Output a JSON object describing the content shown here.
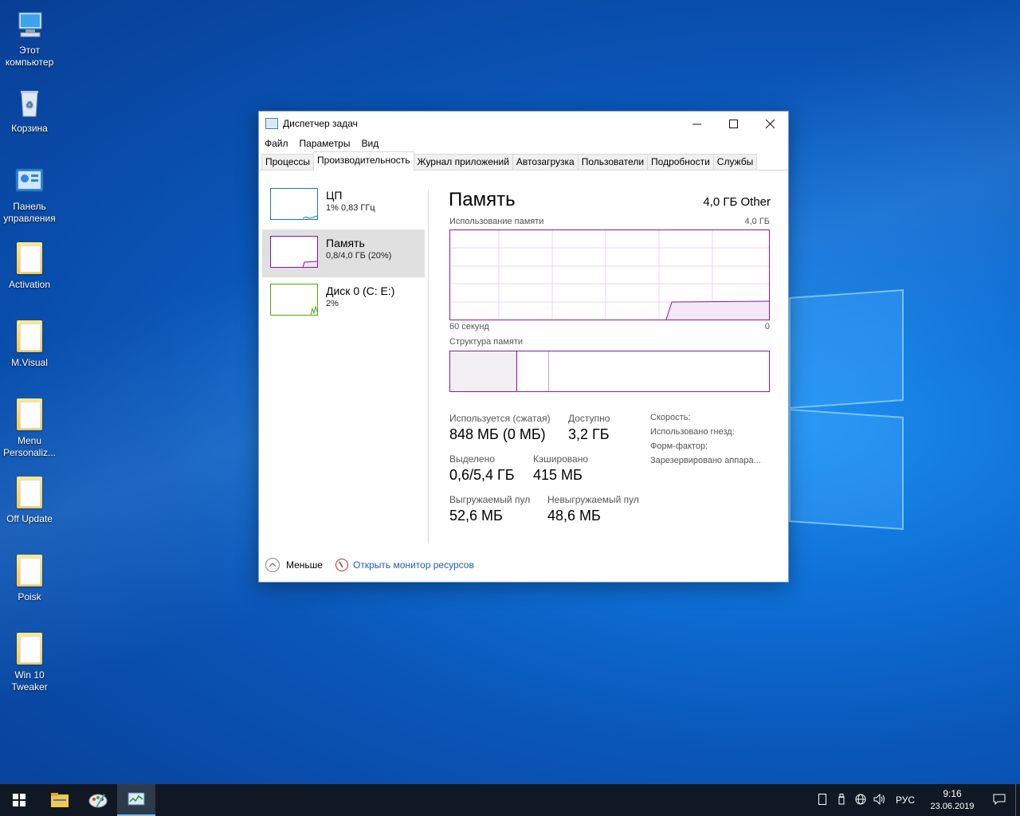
{
  "desktop": {
    "icons": [
      {
        "label": "Этот компьютер",
        "icon": "computer-icon"
      },
      {
        "label": "Корзина",
        "icon": "recycle-bin-icon"
      },
      {
        "label": "Панель управления",
        "icon": "control-panel-icon"
      },
      {
        "label": "Activation",
        "icon": "folder-icon"
      },
      {
        "label": "M.Visual",
        "icon": "folder-icon"
      },
      {
        "label": "Menu Personaliz...",
        "icon": "folder-icon"
      },
      {
        "label": "Off Update",
        "icon": "folder-icon"
      },
      {
        "label": "Poisk",
        "icon": "folder-icon"
      },
      {
        "label": "Win 10 Tweaker",
        "icon": "folder-icon"
      }
    ]
  },
  "window": {
    "title": "Диспетчер задач",
    "menu": [
      "Файл",
      "Параметры",
      "Вид"
    ],
    "tabs": [
      "Процессы",
      "Производительность",
      "Журнал приложений",
      "Автозагрузка",
      "Пользователи",
      "Подробности",
      "Службы"
    ],
    "active_tab": "Производительность",
    "sidebar": [
      {
        "name": "ЦП",
        "detail": "1% 0,83 ГГц",
        "color": "#117dbb"
      },
      {
        "name": "Память",
        "detail": "0,8/4,0 ГБ (20%)",
        "color": "#8b12ae"
      },
      {
        "name": "Диск 0 (C: E:)",
        "detail": "2%",
        "color": "#4da60c"
      }
    ],
    "memory": {
      "title": "Память",
      "total": "4,0 ГБ Other",
      "usage_label": "Использование памяти",
      "usage_max": "4,0 ГБ",
      "axis_left": "60 секунд",
      "axis_right": "0",
      "composition_label": "Структура памяти",
      "in_use_label": "Используется (сжатая)",
      "in_use_value": "848 МБ (0 МБ)",
      "available_label": "Доступно",
      "available_value": "3,2 ГБ",
      "committed_label": "Выделено",
      "committed_value": "0,6/5,4 ГБ",
      "cached_label": "Кэшировано",
      "cached_value": "415 МБ",
      "paged_label": "Выгружаемый пул",
      "paged_value": "52,6 МБ",
      "nonpaged_label": "Невыгружаемый пул",
      "nonpaged_value": "48,6 МБ",
      "props": [
        "Скорость:",
        "Использовано гнезд:",
        "Форм-фактор:",
        "Зарезервировано аппара..."
      ],
      "usage_fraction": 0.2
    },
    "footer": {
      "less": "Меньше",
      "monitor_link": "Открыть монитор ресурсов"
    }
  },
  "taskbar": {
    "language": "РУС",
    "time": "9:16",
    "date": "23.06.2019"
  },
  "colors": {
    "memory_accent": "#8b12ae",
    "link": "#1a5fb4",
    "taskbar": "#101923"
  }
}
